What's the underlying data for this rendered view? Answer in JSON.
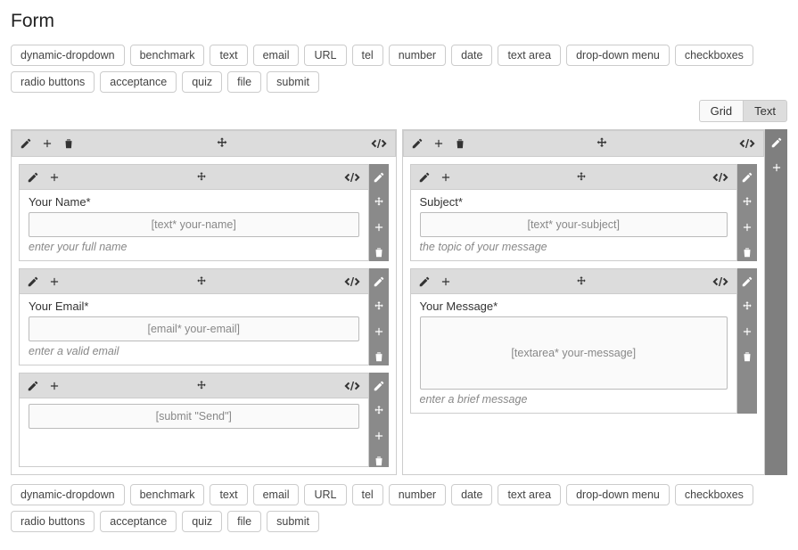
{
  "title": "Form",
  "tags": [
    "dynamic-dropdown",
    "benchmark",
    "text",
    "email",
    "URL",
    "tel",
    "number",
    "date",
    "text area",
    "drop-down menu",
    "checkboxes",
    "radio buttons",
    "acceptance",
    "quiz",
    "file",
    "submit"
  ],
  "viewToggle": {
    "grid": "Grid",
    "text": "Text",
    "active": "text"
  },
  "leftColumn": {
    "items": [
      {
        "label": "Your Name*",
        "placeholder": "[text* your-name]",
        "hint": "enter your full name"
      },
      {
        "label": "Your Email*",
        "placeholder": "[email* your-email]",
        "hint": "enter a valid email"
      },
      {
        "label": "",
        "placeholder": "[submit \"Send\"]",
        "hint": ""
      }
    ]
  },
  "rightColumn": {
    "items": [
      {
        "label": "Subject*",
        "placeholder": "[text* your-subject]",
        "hint": "the topic of your message"
      },
      {
        "label": "Your Message*",
        "placeholder": "[textarea* your-message]",
        "hint": "enter a brief message",
        "textarea": true
      }
    ]
  }
}
